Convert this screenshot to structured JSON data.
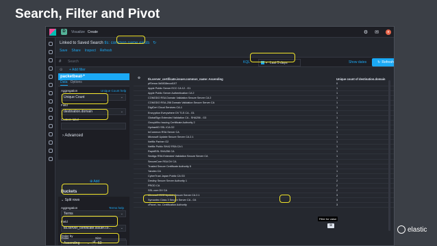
{
  "slide": {
    "title": "Search, Filter and Pivot"
  },
  "header": {
    "breadcrumbs": [
      "Visualize",
      "Create"
    ],
    "space_initial": "D",
    "avatar_initial": "e"
  },
  "linked": {
    "text": "Linked to Saved Search",
    "search_name": "tls: common name exists"
  },
  "menu": [
    "Save",
    "Share",
    "Inspect",
    "Refresh"
  ],
  "querybar": {
    "hash": "#",
    "placeholder": "Search",
    "kql": "KQL",
    "time_range": "Last 5 days",
    "show_dates": "Show dates",
    "refresh": "Refresh"
  },
  "filters": {
    "add_filter": "+ Add filter"
  },
  "sidebar": {
    "index_title": "packetbeat-*",
    "tabs": [
      "Data",
      "Options"
    ],
    "metric": {
      "agg_label": "Aggregation",
      "help_link": "Unique Count help",
      "agg_value": "Unique Count",
      "field_label": "Field",
      "field_value": "destination.domain",
      "custom_label": "Custom label",
      "advanced": "Advanced"
    },
    "add_label": "Add",
    "buckets": {
      "heading": "Buckets",
      "split": "Split rows",
      "agg_label": "Aggregation",
      "help_link": "Terms help",
      "agg_value": "Terms",
      "field_label": "Field",
      "field_value": "tls.server_certificate.issuer.co...",
      "order_by_label": "Order by",
      "order_by_value": "Metric: Unique count of destinatio",
      "order_label": "Order",
      "order_value": "Ascending",
      "size_label": "Size",
      "size_value": "50"
    }
  },
  "table": {
    "col1": "tls.server_certificate.issuer.common_name: Ascending",
    "col2": "Unique count of destination.domain",
    "rows": [
      [
        "pfSense-5d0838eccd107",
        "0"
      ],
      [
        "Apple Public Server ECC CA 12 - G1",
        "1"
      ],
      [
        "Apple Public Server Authentication CA 2",
        "1"
      ],
      [
        "COMODO RSA Domain Validation Secure Server CA 2",
        "1"
      ],
      [
        "COMODO RSA-256 Domain Validation Secure Server CA",
        "1"
      ],
      [
        "DigiCert Cloud Services CA-1",
        "1"
      ],
      [
        "Encryption Everywhere DV TLS CA - G1",
        "1"
      ],
      [
        "GlobalSign Extended Validation CA - SHA256 - G3",
        "1"
      ],
      [
        "GroupWho Issuing Certificate Authority 2",
        "1"
      ],
      [
        "HydrantID SSL ICA G2",
        "1"
      ],
      [
        "InCommon RSA Server CA",
        "1"
      ],
      [
        "Microsoft Update Secure Server CA 2.1",
        "1"
      ],
      [
        "Netflix Partner G2",
        "1"
      ],
      [
        "Netflix Public SHA2 RSA CA 1",
        "1"
      ],
      [
        "RapidSSL SHA256 CA",
        "1"
      ],
      [
        "Sectigo RSA Extended Validation Secure Server CA",
        "1"
      ],
      [
        "SecureCore RSA DV CA",
        "1"
      ],
      [
        "Trusted Secure Certificate Authority 5",
        "1"
      ],
      [
        "Yandex CA",
        "1"
      ],
      [
        "CyberTrust Japan Public CA G3",
        "2"
      ],
      [
        "Destiny Secure Server Authority 1",
        "2"
      ],
      [
        "PROD CA",
        "2"
      ],
      [
        "SSL.com DV CA",
        "2"
      ],
      [
        "Microsoft ECC Update Secure Server CA 2.1",
        "3"
      ],
      [
        "Symantec Class 3 Secure Server CA - G4",
        "3"
      ],
      [
        "cPanel, Inc. Certification Authority",
        "3"
      ]
    ],
    "tooltip": "Filter for value"
  },
  "brand": {
    "name": "elastic"
  },
  "colors": {
    "accent": "#1ba9f5",
    "highlight": "#f3e52a",
    "background": "#3b3f46"
  }
}
